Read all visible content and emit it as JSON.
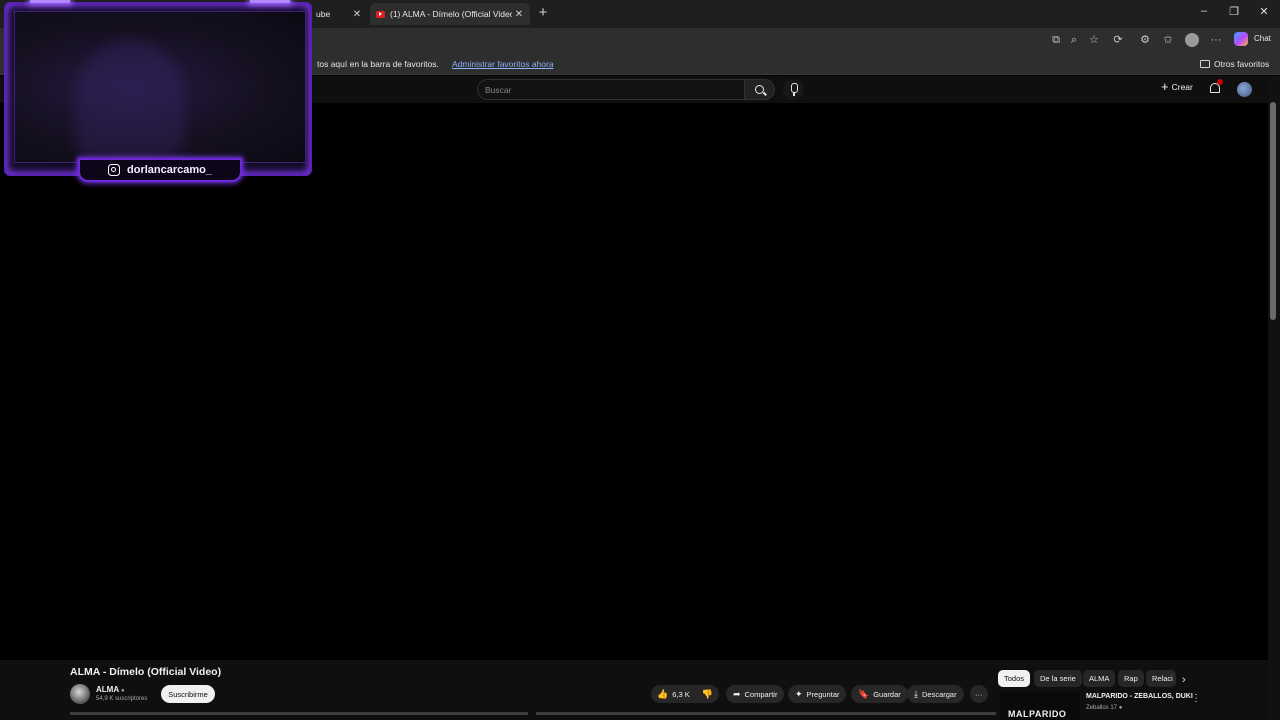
{
  "browser": {
    "tabs": [
      {
        "title": "ube",
        "close": "✕"
      },
      {
        "title": "(1) ALMA - Dímelo (Official Video)",
        "close": "✕"
      }
    ],
    "new_tab": "+",
    "window_controls": {
      "minimize": "–",
      "maximize": "❐",
      "close": "✕"
    },
    "chat_label": "Chat"
  },
  "favorites_bar": {
    "text": "tos aquí en la barra de favoritos.",
    "link": "Administrar favoritos ahora",
    "other": "Otros favoritos"
  },
  "youtube": {
    "search_placeholder": "Buscar",
    "create_label": "Crear",
    "notification_count": "1"
  },
  "overlay": {
    "instagram_handle": "dorlancarcamo_"
  },
  "video": {
    "title": "ALMA - Dímelo (Official Video)",
    "channel": {
      "name": "ALMA",
      "subscribers": "54,9 K suscriptores",
      "subscribe_label": "Suscribirme"
    },
    "actions": {
      "likes": "6,3 K",
      "share": "Compartir",
      "ask": "Preguntar",
      "save": "Guardar",
      "download": "Descargar",
      "more": "···"
    }
  },
  "sidebar": {
    "chips": [
      "Todos",
      "De la serie",
      "ALMA",
      "Rap",
      "Relaci"
    ],
    "active_chip": "Todos",
    "recommendation": {
      "thumb_text": "MALPARIDO",
      "title": "MALPARIDO - ZEBALLOS, DUKI",
      "channel": "Zeballos 17"
    }
  },
  "colors": {
    "accent_purple": "#7c3aed",
    "youtube_bg": "#0f0f0f",
    "link_blue": "#8ab4f8"
  }
}
